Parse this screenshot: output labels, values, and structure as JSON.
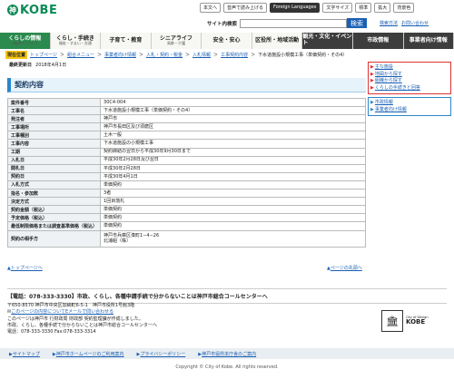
{
  "header": {
    "logo_text": "KOBE",
    "logo_mark": "神",
    "utility": [
      "本文へ",
      "音声で読み上げる",
      "Foreign Languages",
      "文字サイズ",
      "標準",
      "拡大",
      "背景色"
    ],
    "search_label": "サイト内検索",
    "search_button": "検索",
    "links": [
      "検索方法",
      "お問い合わせ"
    ]
  },
  "nav": [
    {
      "label": "くらしの情報",
      "sub": "(総合メニュー)"
    },
    {
      "label": "くらし・手続き",
      "sub": "福祉・すまい・交通"
    },
    {
      "label": "子育て・教育",
      "sub": ""
    },
    {
      "label": "シニアライフ",
      "sub": "高齢・介護"
    },
    {
      "label": "安全・安心",
      "sub": ""
    },
    {
      "label": "区役所・地域活動",
      "sub": ""
    },
    {
      "label": "観光・文化・イベント",
      "sub": ""
    },
    {
      "label": "市政情報",
      "sub": ""
    },
    {
      "label": "事業者向け情報",
      "sub": ""
    }
  ],
  "breadcrumb": {
    "here": "現在位置",
    "items": [
      "トップページ",
      "組合メニュー",
      "事業者向け情報",
      "入札・契約・税金",
      "入札情報",
      "工事契約内容",
      "下水道施設小規模工事（単価契約・その4）"
    ]
  },
  "updated": {
    "label": "最終更新日",
    "value": "2018年4月1日"
  },
  "title": "契約内容",
  "table": [
    {
      "k": "案件番号",
      "v": [
        "30C4-004"
      ]
    },
    {
      "k": "工事名",
      "v": [
        "下水道施設小規模工事（単価契約・その4）"
      ]
    },
    {
      "k": "発注者",
      "v": [
        "神戸市"
      ]
    },
    {
      "k": "工事場所",
      "v": [
        "神戸市長田区及び須磨区"
      ]
    },
    {
      "k": "工事種別",
      "v": [
        "土木一般"
      ]
    },
    {
      "k": "工事内容",
      "v": [
        "下水道施設の小規模工事"
      ]
    },
    {
      "k": "工期",
      "v": [
        "契約締結の翌日から平成30年9月30日まで"
      ]
    },
    {
      "k": "入札日",
      "v": [
        "平成30年2月28日及び翌日"
      ]
    },
    {
      "k": "開札日",
      "v": [
        "平成30年2月28日"
      ]
    },
    {
      "k": "契約日",
      "v": [
        "平成30年4月1日"
      ]
    },
    {
      "k": "入札方式",
      "v": [
        "単価契約"
      ]
    },
    {
      "k": "指名・参加数",
      "v": [
        "3者"
      ]
    },
    {
      "k": "決定方式",
      "v": [
        "1回目落札"
      ]
    },
    {
      "k": "契約金額（税込）",
      "v": [
        "単価契約"
      ]
    },
    {
      "k": "予定価格（税込）",
      "v": [
        "単価契約"
      ]
    },
    {
      "k": "最低制限価格または調査基準価格（税込）",
      "v": [
        "単価契約"
      ]
    },
    {
      "k": "契約の相手方",
      "v": [
        "神戸市兵庫区湊町1−4−26",
        "北浦組（株）"
      ]
    }
  ],
  "sidebar": {
    "red": [
      "主な施設",
      "地図から探す",
      "組織から探す",
      "くらしの手続きと回答"
    ],
    "blue": [
      "市政情報",
      "事業者向け情報"
    ]
  },
  "to_top": "トップページへ",
  "to_top_right": "ページの先頭へ",
  "call_center": "【電話：078-333-3330】市政、くらし、各種申請手続で分からないことは神戸市総合コールセンターへ",
  "info": [
    "〒650-8570 神戸市中央区加納町6-5-1　神戸市役所1号館3階",
    "このページの内容についてEメールで問い合わせる",
    "このページは神戸市 行財政局 財政部 契約監理課が作成しました。",
    "市政、くらし、各種手続で分からないことは神戸市総合コールセンターへ",
    "電話：078-333-3330 Fax:078-333-3314"
  ],
  "unesco": {
    "title": "KOBE",
    "sub": "City of Design"
  },
  "footer_links": [
    "サイトマップ",
    "神戸市ホームページのご利用案内",
    "プライバシーポリシー",
    "神戸市役所本庁舎のご案内"
  ],
  "copyright": "Copyright © City of Kobe. All rights reserved."
}
